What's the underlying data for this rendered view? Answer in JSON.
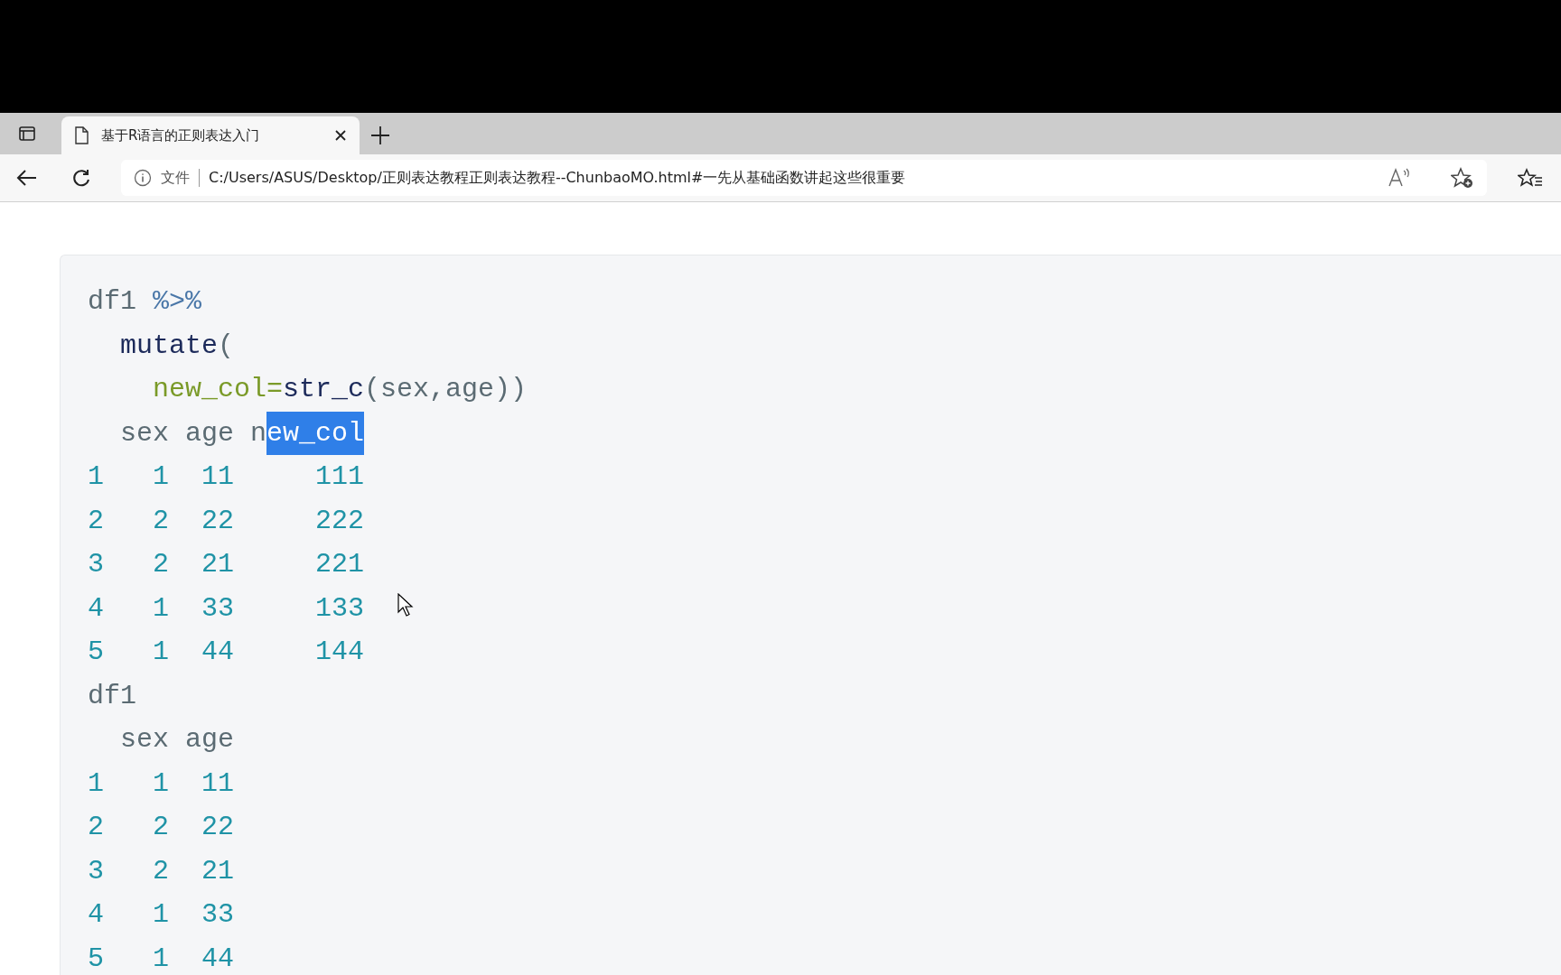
{
  "browser": {
    "tab": {
      "title": "基于R语言的正则表达入门",
      "selected": true
    },
    "address": {
      "scheme_label": "文件",
      "url": "C:/Users/ASUS/Desktop/正则表达教程正则表达教程--ChunbaoMO.html#一先从基础函数讲起这些很重要"
    }
  },
  "code_block": {
    "lines": [
      [
        {
          "text": "df1 ",
          "kind": "plain"
        },
        {
          "text": "%>%",
          "kind": "operator"
        }
      ],
      [
        {
          "text": "  mutate",
          "kind": "function"
        },
        {
          "text": "(",
          "kind": "plain"
        }
      ],
      [
        {
          "text": "    new_col=",
          "kind": "argument"
        },
        {
          "text": "str_c",
          "kind": "function"
        },
        {
          "text": "(sex,age))",
          "kind": "plain"
        }
      ],
      [
        {
          "text": "  sex age n",
          "kind": "plain"
        },
        {
          "text": "ew_col",
          "kind": "selection"
        }
      ],
      [
        {
          "text": "1   1  11     111",
          "kind": "number"
        }
      ],
      [
        {
          "text": "2   2  22     222",
          "kind": "number"
        }
      ],
      [
        {
          "text": "3   2  21     221",
          "kind": "number"
        }
      ],
      [
        {
          "text": "4   1  33     133",
          "kind": "number"
        }
      ],
      [
        {
          "text": "5   1  44     144",
          "kind": "number"
        }
      ],
      [
        {
          "text": "df1",
          "kind": "plain"
        }
      ],
      [
        {
          "text": "  sex age",
          "kind": "plain"
        }
      ],
      [
        {
          "text": "1   1  11",
          "kind": "number"
        }
      ],
      [
        {
          "text": "2   2  22",
          "kind": "number"
        }
      ],
      [
        {
          "text": "3   2  21",
          "kind": "number"
        }
      ],
      [
        {
          "text": "4   1  33",
          "kind": "number"
        }
      ],
      [
        {
          "text": "5   1  44",
          "kind": "number"
        }
      ]
    ]
  }
}
